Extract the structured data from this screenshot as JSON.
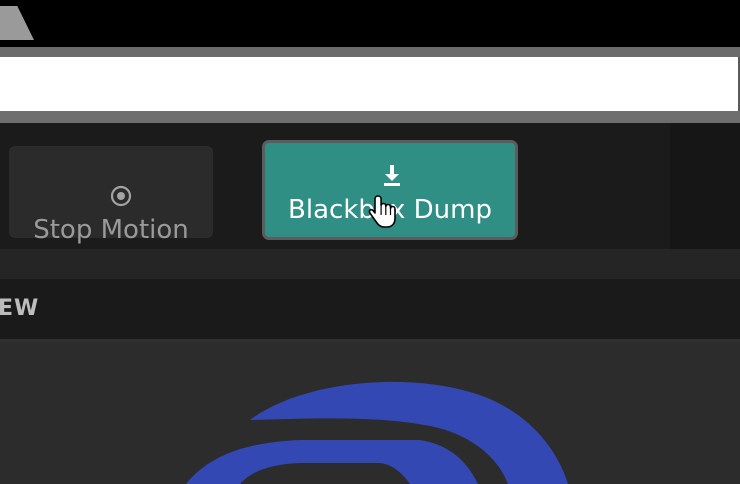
{
  "toolbar": {
    "stop_motion": {
      "label": "Stop Motion",
      "icon": "target-circle-icon"
    },
    "blackbox_dump": {
      "label": "Blackbox Dump",
      "icon": "download-icon"
    }
  },
  "preview": {
    "section_title": "EW",
    "logo": "blue-arc-logo"
  },
  "colors": {
    "accent": "#2f8f85",
    "logo_blue": "#3448b3"
  }
}
